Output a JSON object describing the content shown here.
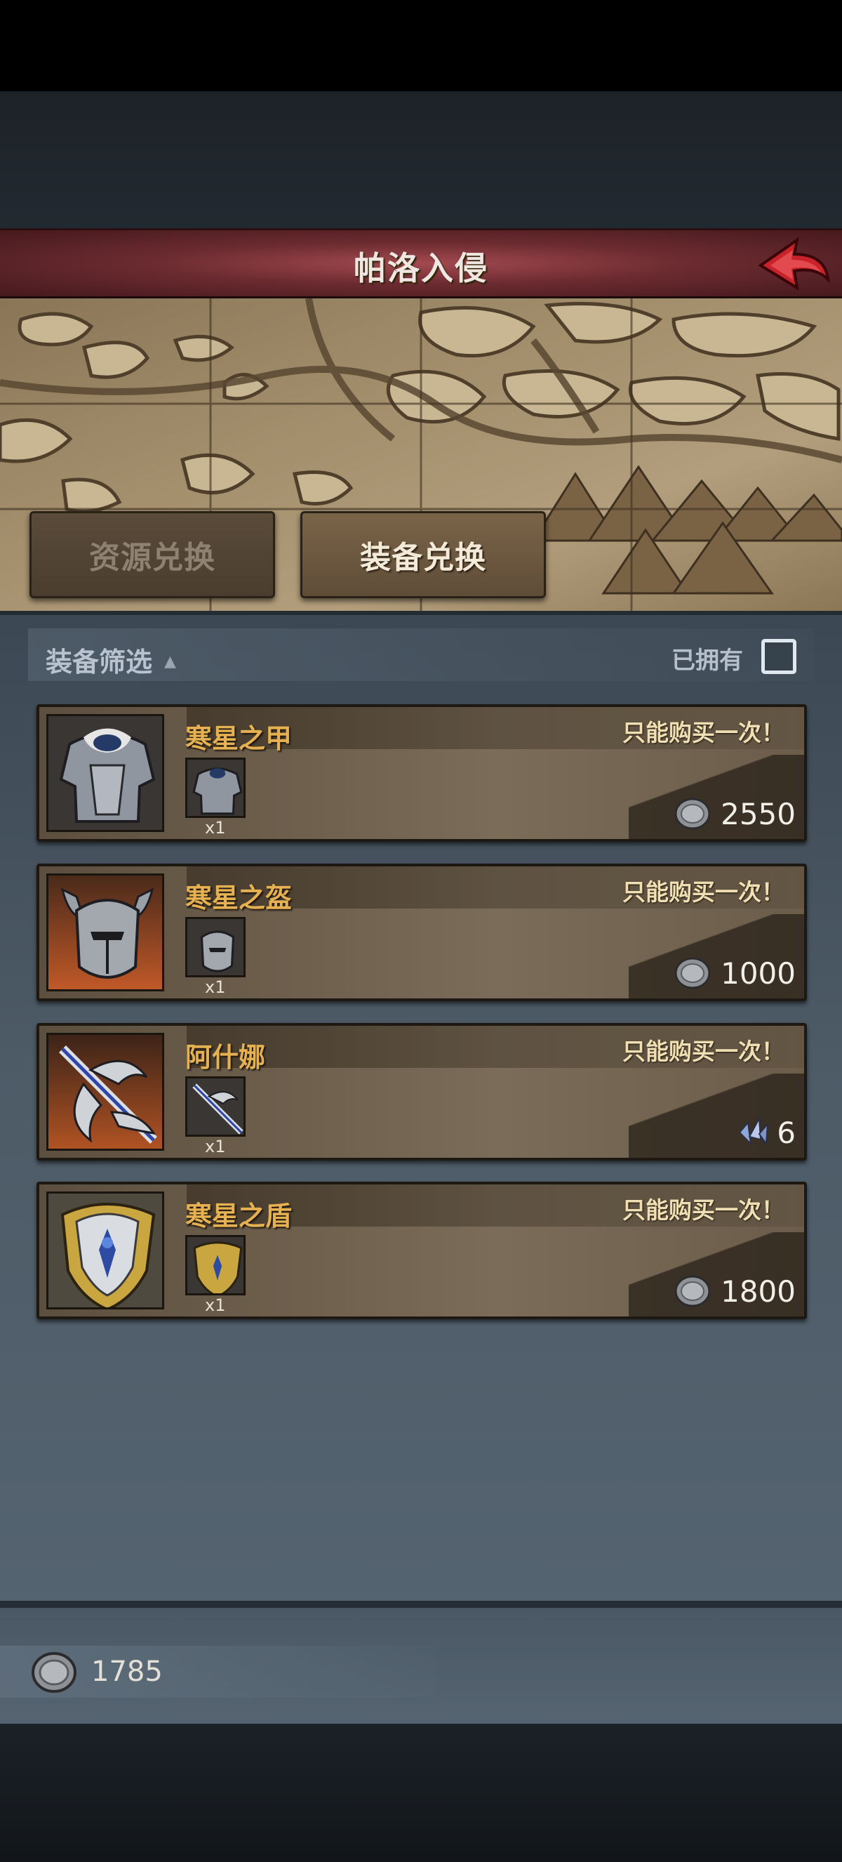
{
  "header": {
    "title": "帕洛入侵",
    "back_icon": "back-arrow-icon"
  },
  "tabs": [
    {
      "label": "资源兑换",
      "active": false
    },
    {
      "label": "装备兑换",
      "active": true
    }
  ],
  "filter": {
    "label": "装备筛选",
    "arrow": "▲",
    "owned_label": "已拥有",
    "owned_checked": false
  },
  "items": [
    {
      "name": "寒星之甲",
      "limit": "只能购买一次！",
      "qty": "x1",
      "price": "2550",
      "currency_icon": "silver-coin-icon",
      "icon": "chest-armor-icon"
    },
    {
      "name": "寒星之盔",
      "limit": "只能购买一次！",
      "qty": "x1",
      "price": "1000",
      "currency_icon": "silver-coin-icon",
      "icon": "helmet-icon"
    },
    {
      "name": "阿什娜",
      "limit": "只能购买一次！",
      "qty": "x1",
      "price": "6",
      "currency_icon": "crystal-shard-icon",
      "icon": "weapon-crest-icon"
    },
    {
      "name": "寒星之盾",
      "limit": "只能购买一次！",
      "qty": "x1",
      "price": "1800",
      "currency_icon": "silver-coin-icon",
      "icon": "shield-icon"
    }
  ],
  "footer": {
    "balance": "1785",
    "currency_icon": "silver-coin-icon"
  },
  "colors": {
    "item_name": "#e5b151",
    "title_bar": "#6b2b30",
    "panel": "#4d5b67"
  }
}
